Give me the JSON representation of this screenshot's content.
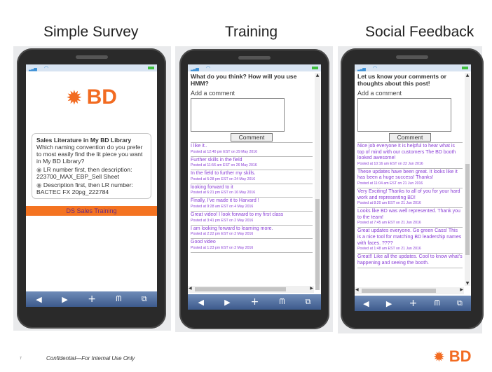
{
  "panels": [
    {
      "title": "Simple Survey"
    },
    {
      "title": "Training"
    },
    {
      "title": "Social Feedback"
    }
  ],
  "survey": {
    "logo_text": "BD",
    "question_title": "Sales Literature in My BD Library",
    "question_text": "Which naming convention do you prefer to most easily find the lit piece you want in My BD Library?",
    "options": [
      "LR number first, then description: 223700_MAX_EBP_Sell Sheet",
      "Description first, then LR number: BACTEC FX 20pg_222784"
    ],
    "banner": "DS Sales Training"
  },
  "training": {
    "prompt": "What do you think? How will you use HMM?",
    "add_label": "Add a comment",
    "button": "Comment",
    "comments": [
      {
        "text": "I like it..",
        "date": "Posted at 12:40 pm EST on 29 May 2016"
      },
      {
        "text": "Further skills in the field",
        "date": "Posted at 11:56 am EST on 26 May 2016"
      },
      {
        "text": "In the field to further my skills.",
        "date": "Posted at 5:28 pm EST on 24 May 2016"
      },
      {
        "text": "looking forward to it",
        "date": "Posted at 6:21 pm EST on 16 May 2016"
      },
      {
        "text": "Finally, I've made it to Harvard !",
        "date": "Posted at 9:28 am EST on 4 May 2016"
      },
      {
        "text": "Great video! I look forward to my first class",
        "date": "Posted at 3:41 pm EST on 2 May 2016"
      },
      {
        "text": "I am looking forward to learning more.",
        "date": "Posted at 2:22 pm EST on 2 May 2016"
      },
      {
        "text": "Good video",
        "date": "Posted at 1:23 pm EST on 2 May 2016"
      }
    ]
  },
  "social": {
    "prompt": "Let us know your comments or thoughts about this post!",
    "add_label": "Add a comment",
    "button": "Comment",
    "comments": [
      {
        "text": "Nice job everyone It is helpful to hear what is top of mind with our customers The BD booth looked awesome!",
        "date": "Posted at 10:16 am EST on 22 Jun 2016"
      },
      {
        "text": "These updates have been great. It looks like it has been a huge success! Thanks!",
        "date": "Posted at 11:04 am EST on 21 Jun 2016"
      },
      {
        "text": "Very Exciting! Thanks to all of you for your hard work and representing BD!",
        "date": "Posted at 8:20 am EST on 21 Jun 2016"
      },
      {
        "text": "Looks like BD was well represented. Thank you to the team!",
        "date": "Posted at 7:45 am EST on 21 Jun 2016"
      },
      {
        "text": "Great updates everyone. Go green Cass! This is a nice tool for matching BD leadership names with faces. ????",
        "date": "Posted at 1:48 am EST on 21 Jun 2016"
      },
      {
        "text": "Great!! Like all the updates. Cool to know what's happening and seeing the booth.",
        "date": ""
      }
    ]
  },
  "footer": {
    "page_number": "7",
    "confidential": "Confidential—For Internal Use Only",
    "logo_text": "BD"
  },
  "colors": {
    "brand_orange": "#f26b21",
    "comment_purple": "#8a3ed6",
    "phone_body": "#2a2a2a",
    "nav_blue": "#3d5a8c"
  },
  "icons": {
    "nav": [
      "back-icon",
      "forward-icon",
      "add-icon",
      "bookmarks-icon",
      "tabs-icon"
    ],
    "logo": "bd-sunburst-icon"
  }
}
